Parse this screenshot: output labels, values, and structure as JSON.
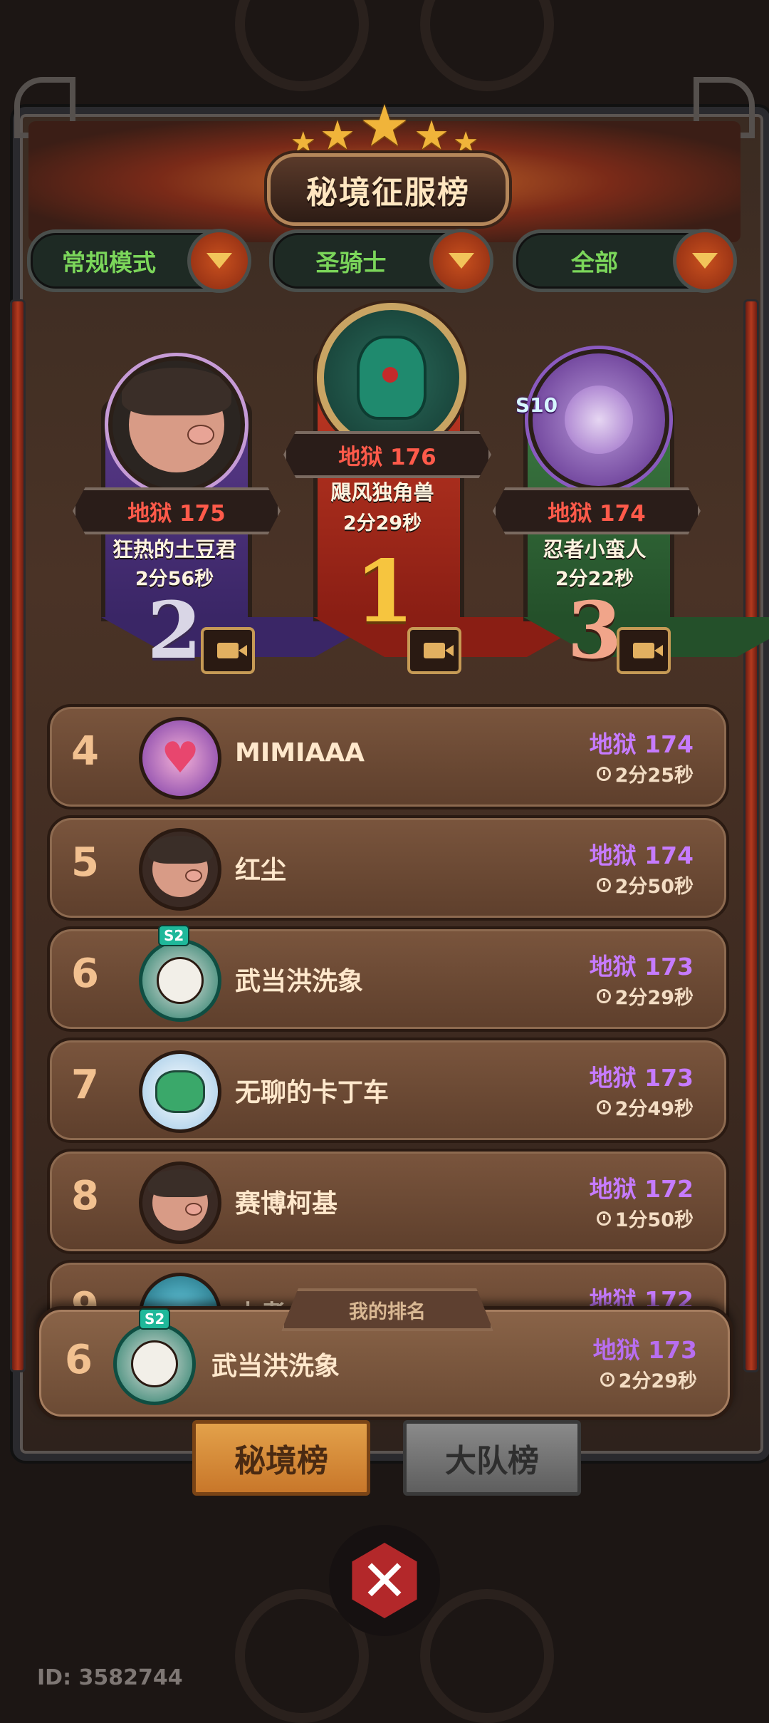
{
  "header": {
    "title": "秘境征服榜",
    "stars": 5
  },
  "filters": [
    {
      "label": "常规模式"
    },
    {
      "label": "圣骑士"
    },
    {
      "label": "全部"
    }
  ],
  "podium": [
    {
      "rank": "2",
      "score": "地狱 175",
      "name": "狂热的土豆君",
      "time": "2分56秒"
    },
    {
      "rank": "1",
      "score": "地狱 176",
      "name": "飓风独角兽",
      "time": "2分29秒"
    },
    {
      "rank": "3",
      "score": "地狱 174",
      "name": "忍者小蛮人",
      "time": "2分22秒",
      "season": "S10"
    }
  ],
  "list": [
    {
      "rank": "4",
      "name": "MIMIAAA",
      "score": "地狱 174",
      "time": "2分25秒"
    },
    {
      "rank": "5",
      "name": "红尘",
      "score": "地狱 174",
      "time": "2分50秒"
    },
    {
      "rank": "6",
      "name": "武当洪洗象",
      "score": "地狱 173",
      "time": "2分29秒",
      "season": "S2"
    },
    {
      "rank": "7",
      "name": "无聊的卡丁车",
      "score": "地狱 173",
      "time": "2分49秒"
    },
    {
      "rank": "8",
      "name": "赛博柯基",
      "score": "地狱 172",
      "time": "1分50秒"
    },
    {
      "rank": "9",
      "name": "水煮",
      "score": "地狱 172",
      "time": ""
    }
  ],
  "my_rank": {
    "label": "我的排名",
    "rank": "6",
    "name": "武当洪洗象",
    "score": "地狱 173",
    "time": "2分29秒",
    "season": "S2"
  },
  "tabs": [
    {
      "label": "秘境榜",
      "active": true
    },
    {
      "label": "大队榜",
      "active": false
    }
  ],
  "footer": {
    "user_id": "ID: 3582744"
  },
  "colors": {
    "score_red": "#ff5a4a",
    "score_purple": "#c67bff",
    "filter_green": "#7bd65a",
    "tab_active": "#e3a14a"
  }
}
